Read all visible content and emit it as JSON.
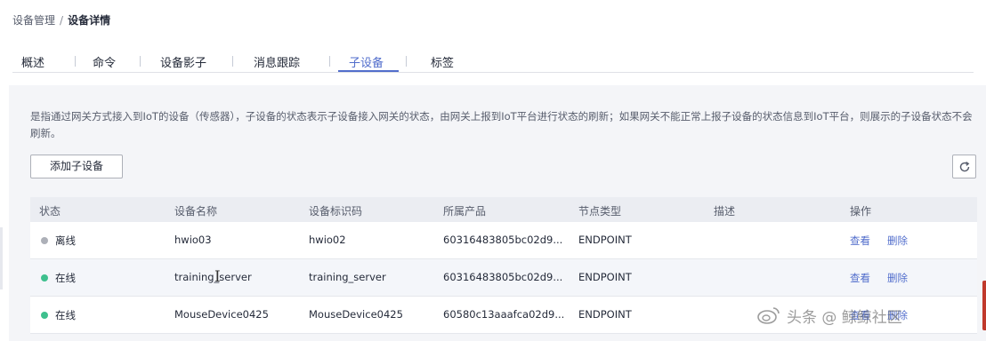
{
  "breadcrumb": {
    "parent": "设备管理",
    "separator": "/",
    "current": "设备详情"
  },
  "tabs": [
    {
      "label": "概述",
      "active": false
    },
    {
      "label": "命令",
      "active": false
    },
    {
      "label": "设备影子",
      "active": false
    },
    {
      "label": "消息跟踪",
      "active": false
    },
    {
      "label": "子设备",
      "active": true
    },
    {
      "label": "标签",
      "active": false
    }
  ],
  "description": "是指通过网关方式接入到IoT的设备（传感器），子设备的状态表示子设备接入网关的状态，由网关上报到IoT平台进行状态的刷新；如果网关不能正常上报子设备的状态信息到IoT平台，则展示的子设备状态不会刷新。",
  "toolbar": {
    "add_label": "添加子设备",
    "refresh_icon": "refresh-icon"
  },
  "table": {
    "columns": [
      "状态",
      "设备名称",
      "设备标识码",
      "所属产品",
      "节点类型",
      "描述",
      "操作"
    ],
    "rows": [
      {
        "status": "离线",
        "status_color": "#adb0b8",
        "name": "hwio03",
        "identifier": "hwio02",
        "product": "60316483805bc02d9...",
        "node_type": "ENDPOINT",
        "description": "",
        "view": "查看",
        "delete": "删除"
      },
      {
        "status": "在线",
        "status_color": "#3ec08e",
        "name": "training_server",
        "identifier": "training_server",
        "product": "60316483805bc02d9...",
        "node_type": "ENDPOINT",
        "description": "",
        "view": "查看",
        "delete": "删除"
      },
      {
        "status": "在线",
        "status_color": "#3ec08e",
        "name": "MouseDevice0425",
        "identifier": "MouseDevice0425",
        "product": "60580c13aaafca02d9...",
        "node_type": "ENDPOINT",
        "description": "",
        "view": "查看",
        "delete": "删除"
      }
    ]
  },
  "watermark": "头条 @ 鲸鲸社区"
}
